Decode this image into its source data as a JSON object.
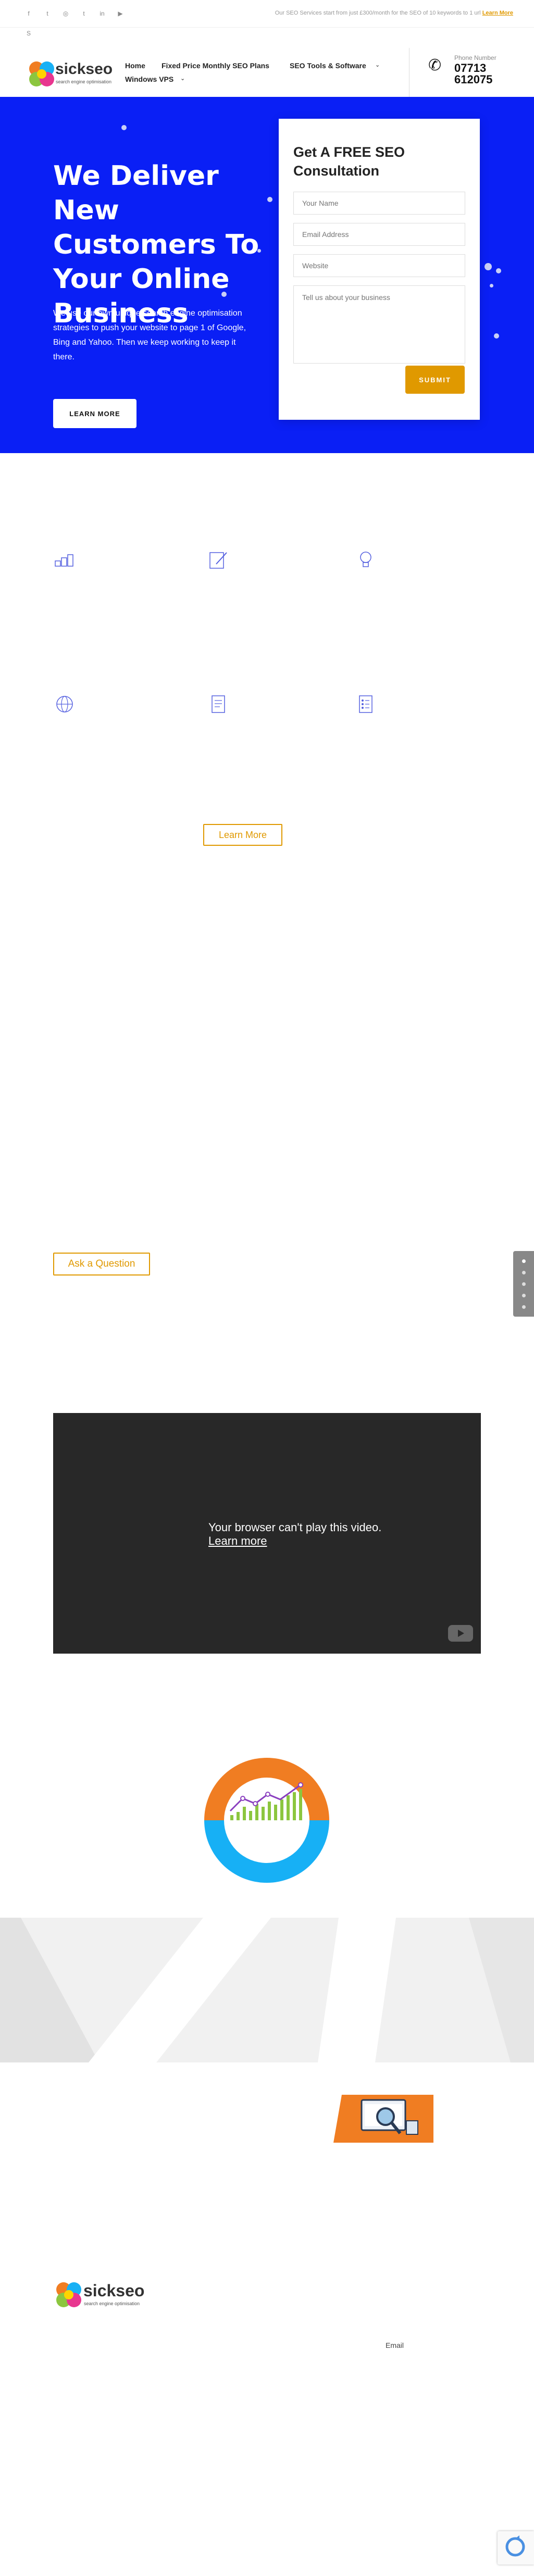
{
  "topbar": {
    "social": [
      "facebook-icon",
      "twitter-icon",
      "instagram-icon",
      "tumblr-icon",
      "linkedin-icon",
      "youtube-icon",
      "skype-icon"
    ],
    "promo_text": "Our SEO Services start from just £300/month for the SEO of 10 keywords to 1 url",
    "promo_link": "Learn More"
  },
  "header": {
    "logo_name": "sickseo",
    "logo_tagline": "search engine optimisation",
    "nav": [
      "Home",
      "Fixed Price Monthly SEO Plans",
      "SEO Tools & Software",
      "Windows VPS"
    ],
    "phone_label": "Phone Number",
    "phone_number": "07713 612075"
  },
  "hero": {
    "title": "We Deliver New Customers To Your Online Business",
    "text": "We use our own unique search engine optimisation strategies to push your website to page 1 of Google, Bing and Yahoo. Then we keep working to keep it there.",
    "button": "LEARN MORE"
  },
  "form": {
    "title": "Get A FREE SEO Consultation",
    "name_placeholder": "Your Name",
    "email_placeholder": "Email Address",
    "website_placeholder": "Website",
    "message_placeholder": "Tell us about your business",
    "submit": "SUBMIT"
  },
  "features": {
    "icons": [
      "chart-bars-icon",
      "edit-document-icon",
      "lightbulb-icon",
      "globe-icon",
      "document-icon",
      "checklist-icon"
    ],
    "learn_more": "Learn More"
  },
  "ask_button": "Ask a Question",
  "video": {
    "message": "Your browser can't play this video.",
    "link": "Learn more"
  },
  "footer": {
    "logo_name": "sickseo",
    "logo_tagline": "search engine optimisation",
    "email_label": "Email"
  },
  "colors": {
    "hero_blue": "#0a1ff5",
    "accent_orange": "#e09900",
    "chart_orange": "#f07d22",
    "chart_blue": "#17b0f5",
    "chart_green": "#8cc63f"
  }
}
